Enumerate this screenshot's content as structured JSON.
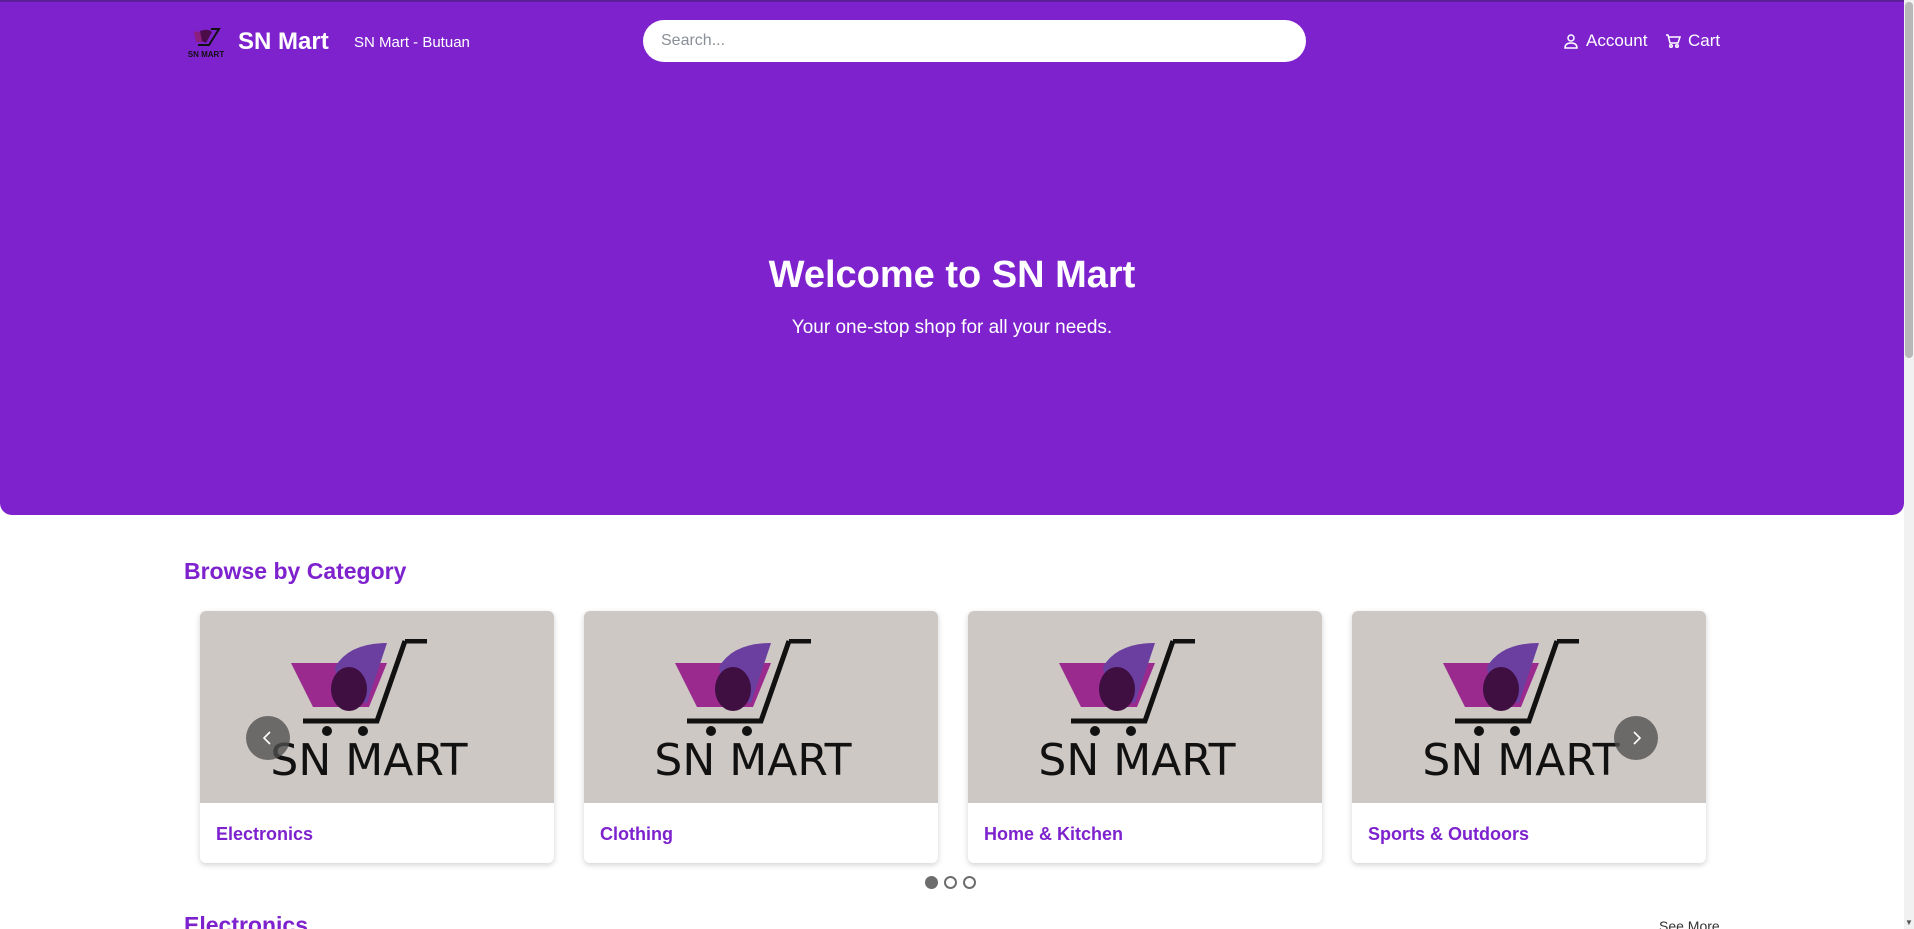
{
  "header": {
    "brand": "SN Mart",
    "store_location": "SN Mart - Butuan",
    "search_placeholder": "Search...",
    "account_label": "Account",
    "cart_label": "Cart",
    "logo_text": "SN MART"
  },
  "hero": {
    "title": "Welcome to SN Mart",
    "subtitle": "Your one-stop shop for all your needs."
  },
  "categories": {
    "title": "Browse by Category",
    "items": [
      {
        "label": "Electronics",
        "image_text": "SN MART"
      },
      {
        "label": "Clothing",
        "image_text": "SN MART"
      },
      {
        "label": "Home & Kitchen",
        "image_text": "SN MART"
      },
      {
        "label": "Sports & Outdoors",
        "image_text": "SN MART"
      }
    ],
    "active_page": 1,
    "page_count": 3
  },
  "electronics": {
    "title": "Electronics",
    "see_more": "See More"
  },
  "colors": {
    "brand_purple": "#7e22ce",
    "card_image_bg": "#cdc8c4"
  }
}
